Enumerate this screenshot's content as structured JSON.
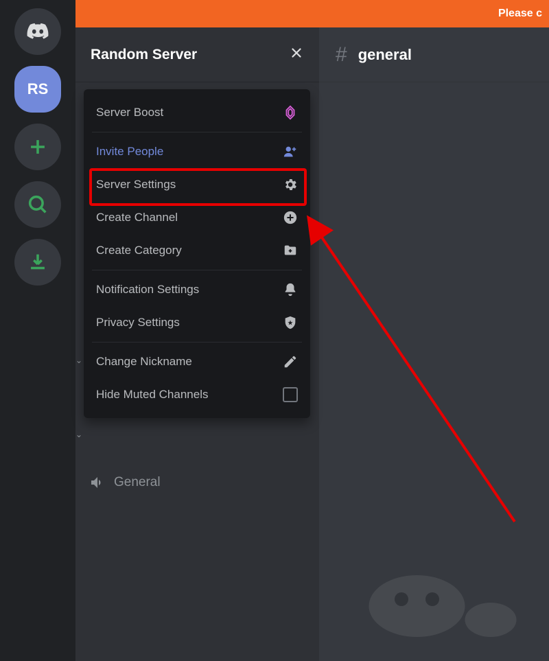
{
  "banner": {
    "text": "Please c"
  },
  "guilds": {
    "selected_initials": "RS"
  },
  "server": {
    "name": "Random Server"
  },
  "dropdown": {
    "boost": "Server Boost",
    "invite": "Invite People",
    "settings": "Server Settings",
    "create_channel": "Create Channel",
    "create_category": "Create Category",
    "notifications": "Notification Settings",
    "privacy": "Privacy Settings",
    "nickname": "Change Nickname",
    "hide_muted": "Hide Muted Channels"
  },
  "channels": {
    "voice_general": "General"
  },
  "chat": {
    "current_channel": "general"
  },
  "highlight": {
    "target": "server-settings"
  }
}
